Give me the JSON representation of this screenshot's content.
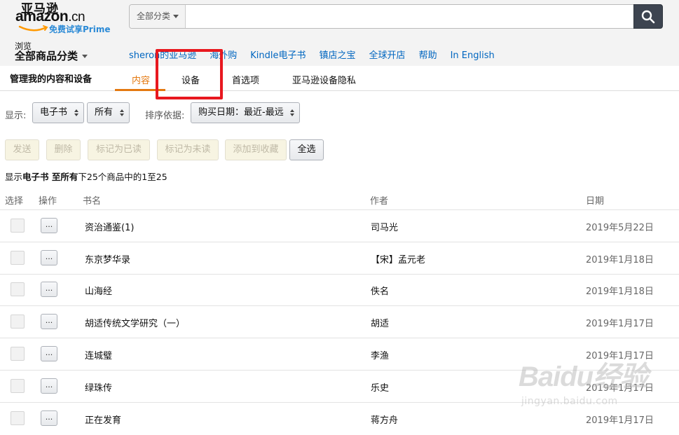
{
  "header": {
    "logo_top": "亚马逊",
    "logo_main": "amazon",
    "logo_suffix": ".cn",
    "logo_prime": "免费试享Prime",
    "search_category": "全部分类",
    "search_placeholder": "",
    "browse_label": "浏览",
    "browse_main": "全部商品分类",
    "nav_links": [
      "sheron的亚马逊",
      "海外购",
      "Kindle电子书",
      "镇店之宝",
      "全球开店",
      "帮助",
      "In English"
    ]
  },
  "subnav": {
    "title": "管理我的内容和设备",
    "tabs": [
      "内容",
      "设备",
      "首选项",
      "亚马逊设备隐私"
    ],
    "active_tab": "内容"
  },
  "filters": {
    "show_label": "显示:",
    "type_value": "电子书",
    "scope_value": "所有",
    "sort_label": "排序依据:",
    "sort_value": "购买日期：最近-最远"
  },
  "actions": [
    "发送",
    "删除",
    "标记为已读",
    "标记为未读",
    "添加到收藏",
    "全选"
  ],
  "summary": {
    "prefix": "显示",
    "type": "电子书",
    "middle": " 至",
    "scope": "所有",
    "suffix": "下25个商品中的1至25"
  },
  "table": {
    "headers": [
      "选择",
      "操作",
      "书名",
      "作者",
      "日期"
    ],
    "op_label": "...",
    "rows": [
      {
        "title": "资治通鉴(1)",
        "author": "司马光",
        "date": "2019年5月22日"
      },
      {
        "title": "东京梦华录",
        "author": "【宋】孟元老",
        "date": "2019年1月18日"
      },
      {
        "title": "山海经",
        "author": "佚名",
        "date": "2019年1月18日"
      },
      {
        "title": "胡适传统文学研究（一）",
        "author": "胡适",
        "date": "2019年1月17日"
      },
      {
        "title": "连城璧",
        "author": "李渔",
        "date": "2019年1月17日"
      },
      {
        "title": "绿珠传",
        "author": "乐史",
        "date": "2019年1月17日"
      },
      {
        "title": "正在发育",
        "author": "蒋方舟",
        "date": "2019年1月17日"
      }
    ]
  },
  "watermark": {
    "main": "Baidu经验",
    "sub": "jingyan.baidu.com"
  },
  "colors": {
    "accent": "#e47911",
    "link": "#0066c0",
    "highlight": "#e8181f",
    "search_button": "#3d4450"
  },
  "icons": {
    "search": "search-icon",
    "caret": "chevron-down-icon"
  }
}
